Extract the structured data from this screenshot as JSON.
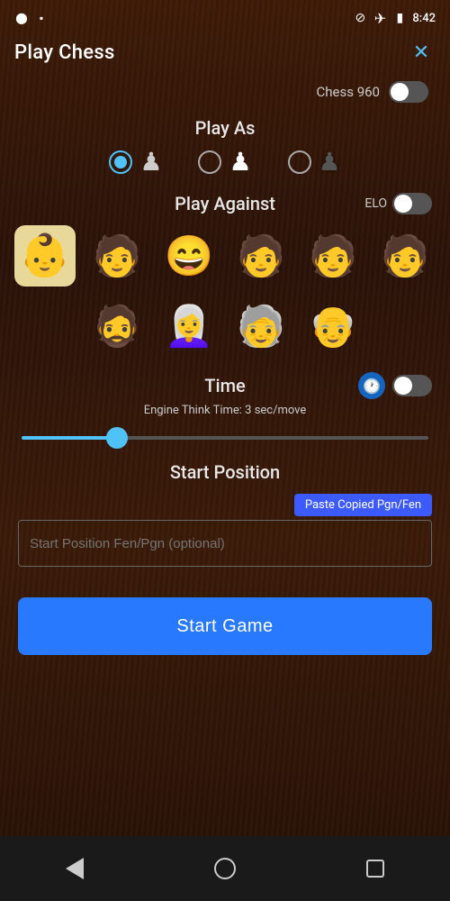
{
  "statusBar": {
    "time": "8:42",
    "icons": [
      "signal-off-icon",
      "airplane-icon",
      "battery-icon"
    ]
  },
  "header": {
    "title": "Play Chess",
    "closeLabel": "✕"
  },
  "chess960": {
    "label": "Chess 960",
    "enabled": false
  },
  "playAs": {
    "title": "Play As",
    "options": [
      {
        "id": "white",
        "selected": true,
        "piece": "♙"
      },
      {
        "id": "random",
        "selected": false,
        "piece": "♟"
      },
      {
        "id": "black",
        "selected": false,
        "piece": "♟"
      }
    ]
  },
  "playAgainst": {
    "title": "Play Against",
    "eloLabel": "ELO",
    "eloEnabled": false,
    "opponents": [
      {
        "emoji": "👶",
        "selected": true
      },
      {
        "emoji": "🧑",
        "selected": false
      },
      {
        "emoji": "😊",
        "selected": false
      },
      {
        "emoji": "🧑‍🦱",
        "selected": false
      },
      {
        "emoji": "🧑",
        "selected": false
      },
      {
        "emoji": "🧑",
        "selected": false
      },
      {
        "emoji": "🧔",
        "selected": false
      },
      {
        "emoji": "👩‍🦳",
        "selected": false
      },
      {
        "emoji": "🧓",
        "selected": false
      },
      {
        "emoji": "👴",
        "selected": false
      }
    ]
  },
  "time": {
    "title": "Time",
    "engineText": "Engine Think Time: 3 sec/move",
    "sliderValue": 22,
    "timeEnabled": false
  },
  "startPosition": {
    "title": "Start Position",
    "pasteBtnLabel": "Paste Copied Pgn/Fen",
    "inputPlaceholder": "Start Position Fen/Pgn (optional)",
    "inputValue": ""
  },
  "startGame": {
    "label": "Start Game"
  },
  "navBar": {
    "back": "back",
    "home": "home",
    "recent": "recent"
  }
}
